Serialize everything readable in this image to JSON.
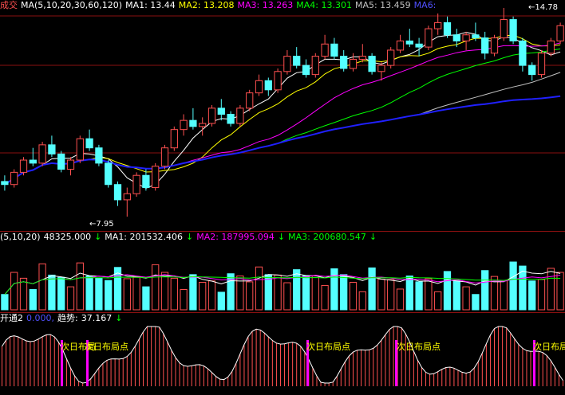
{
  "colors": {
    "up": "#ff5050",
    "down": "#54ffff",
    "ma5": "#ffffff",
    "ma10": "#ffff00",
    "ma20": "#ff00ff",
    "ma30": "#00ff00",
    "ma60": "#c0c0c0",
    "ma120": "#2020ff",
    "grid": "#8a1010",
    "header_white": "#ffffff",
    "header_yellow": "#ffff00",
    "header_magenta": "#ff00ff",
    "header_green": "#00ff00",
    "header_blue": "#5050ff"
  },
  "price_panel": {
    "header": {
      "name": "成交",
      "params": "MA(5,10,20,30,60,120)",
      "ma1": "MA1: 13.44",
      "ma2": "MA2: 13.208",
      "ma3": "MA3: 13.263",
      "ma4": "MA4: 13.301",
      "ma5": "MA5: 13.459",
      "ma6": "MA6:"
    },
    "high_label": "14.78",
    "low_label": "7.95"
  },
  "volume_panel": {
    "header": {
      "params": "(5,10,20)",
      "vol": "48325.000",
      "ma1": "MA1: 201532.406",
      "ma2": "MA2: 187995.094",
      "ma3": "MA3: 200680.547",
      "arrow": "↓"
    }
  },
  "indicator_panel": {
    "header": {
      "name": "开通2",
      "value": "0.000,",
      "trend_label": "趋势:",
      "trend_value": "37.167",
      "arrow": "↓"
    },
    "signals": [
      "次日布局",
      "次日布局点",
      "次日布局点",
      "次日布局点",
      "次日布局"
    ]
  },
  "chart_data": {
    "type": "candlestick",
    "price_range": [
      7.95,
      14.78
    ],
    "candles": [
      [
        9.1,
        9.3,
        8.8,
        9.0
      ],
      [
        9.0,
        9.5,
        8.9,
        9.4
      ],
      [
        9.4,
        9.9,
        9.3,
        9.8
      ],
      [
        9.8,
        10.2,
        9.6,
        9.7
      ],
      [
        9.7,
        10.4,
        9.6,
        10.3
      ],
      [
        10.3,
        10.6,
        9.9,
        10.0
      ],
      [
        10.0,
        10.1,
        9.4,
        9.5
      ],
      [
        9.5,
        9.9,
        9.3,
        9.8
      ],
      [
        9.8,
        10.6,
        9.7,
        10.5
      ],
      [
        10.5,
        10.8,
        10.1,
        10.2
      ],
      [
        10.2,
        10.3,
        9.6,
        9.7
      ],
      [
        9.7,
        9.8,
        8.9,
        9.0
      ],
      [
        9.0,
        9.1,
        8.3,
        8.5
      ],
      [
        8.5,
        8.9,
        7.95,
        8.7
      ],
      [
        8.7,
        9.4,
        8.6,
        9.3
      ],
      [
        9.3,
        9.5,
        8.8,
        8.9
      ],
      [
        8.9,
        9.7,
        8.8,
        9.6
      ],
      [
        9.6,
        10.3,
        9.5,
        10.2
      ],
      [
        10.2,
        10.9,
        10.1,
        10.8
      ],
      [
        10.8,
        11.3,
        10.6,
        11.1
      ],
      [
        11.1,
        11.5,
        10.8,
        10.9
      ],
      [
        10.9,
        11.2,
        10.6,
        11.0
      ],
      [
        11.0,
        11.6,
        10.9,
        11.5
      ],
      [
        11.5,
        11.8,
        11.1,
        11.3
      ],
      [
        11.3,
        11.4,
        10.9,
        11.0
      ],
      [
        11.0,
        11.6,
        10.9,
        11.5
      ],
      [
        11.5,
        12.1,
        11.4,
        12.0
      ],
      [
        12.0,
        12.6,
        11.9,
        12.4
      ],
      [
        12.4,
        12.5,
        11.9,
        12.1
      ],
      [
        12.1,
        12.8,
        12.0,
        12.7
      ],
      [
        12.7,
        13.4,
        12.6,
        13.2
      ],
      [
        13.2,
        13.5,
        12.8,
        12.9
      ],
      [
        12.9,
        13.1,
        12.5,
        12.6
      ],
      [
        12.6,
        13.3,
        12.5,
        13.2
      ],
      [
        13.2,
        13.9,
        13.1,
        13.6
      ],
      [
        13.6,
        13.8,
        13.1,
        13.2
      ],
      [
        13.2,
        13.4,
        12.7,
        12.8
      ],
      [
        12.8,
        13.3,
        12.7,
        13.1
      ],
      [
        13.1,
        13.6,
        13.0,
        13.2
      ],
      [
        13.2,
        13.3,
        12.6,
        12.7
      ],
      [
        12.7,
        13.0,
        12.4,
        12.9
      ],
      [
        12.9,
        13.5,
        12.8,
        13.4
      ],
      [
        13.4,
        13.9,
        13.3,
        13.7
      ],
      [
        13.7,
        14.1,
        13.5,
        13.6
      ],
      [
        13.6,
        13.8,
        13.2,
        13.5
      ],
      [
        13.5,
        14.2,
        13.4,
        14.1
      ],
      [
        14.1,
        14.6,
        13.9,
        14.3
      ],
      [
        14.3,
        14.5,
        13.8,
        13.9
      ],
      [
        13.9,
        14.1,
        13.5,
        13.7
      ],
      [
        13.7,
        14.0,
        13.4,
        13.9
      ],
      [
        13.9,
        14.3,
        13.7,
        13.8
      ],
      [
        13.8,
        14.0,
        13.1,
        13.3
      ],
      [
        13.3,
        13.9,
        13.2,
        13.8
      ],
      [
        13.8,
        14.78,
        13.7,
        14.4
      ],
      [
        14.4,
        14.5,
        13.6,
        13.7
      ],
      [
        13.7,
        13.8,
        12.7,
        12.9
      ],
      [
        12.9,
        13.0,
        12.4,
        12.6
      ],
      [
        12.6,
        13.4,
        12.5,
        13.3
      ],
      [
        13.3,
        13.8,
        13.2,
        13.7
      ],
      [
        13.7,
        14.3,
        13.6,
        14.2
      ]
    ]
  }
}
